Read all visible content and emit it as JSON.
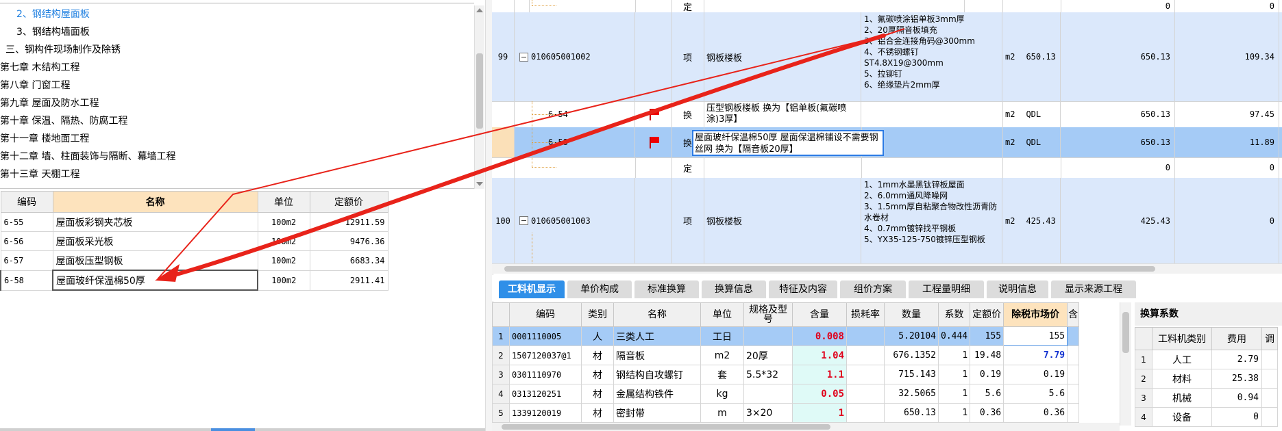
{
  "tree": {
    "items": [
      {
        "label": "2、钢结构屋面板",
        "selected": true
      },
      {
        "label": "3、钢结构墙面板",
        "selected": false
      },
      {
        "label": "三、钢构件现场制作及除锈",
        "selected": false
      },
      {
        "label": "第七章  木结构工程",
        "selected": false
      },
      {
        "label": "第八章  门窗工程",
        "selected": false
      },
      {
        "label": "第九章  屋面及防水工程",
        "selected": false
      },
      {
        "label": "第十章  保温、隔热、防腐工程",
        "selected": false
      },
      {
        "label": "第十一章  楼地面工程",
        "selected": false
      },
      {
        "label": "第十二章  墙、柱面装饰与隔断、幕墙工程",
        "selected": false
      },
      {
        "label": "第十三章  天棚工程",
        "selected": false
      }
    ]
  },
  "quota_table": {
    "headers": [
      "编码",
      "名称",
      "单位",
      "定额价"
    ],
    "rows": [
      {
        "code": "6-55",
        "name": "屋面板彩钢夹芯板",
        "unit": "100m2",
        "price": "12911.59"
      },
      {
        "code": "6-56",
        "name": "屋面板采光板",
        "unit": "100m2",
        "price": "9476.36"
      },
      {
        "code": "6-57",
        "name": "屋面板压型钢板",
        "unit": "100m2",
        "price": "6683.34"
      },
      {
        "code": "6-58",
        "name": "屋面玻纤保温棉50厚",
        "unit": "100m2",
        "price": "2911.41"
      }
    ]
  },
  "grid": {
    "row0": {
      "type": "定",
      "total": "0",
      "amount": "0"
    },
    "row99": {
      "seq": "99",
      "code": "010605001002",
      "type": "项",
      "name": "钢板楼板",
      "desc": "1、氟碳喷涂铝单板3mm厚\n2、20厚隔音板填充\n3、铝合金连接角码@300mm\n4、不锈钢螺钉\nST4.8X19@300mm\n5、拉铆钉\n6、绝缘垫片2mm厚",
      "unit": "m2",
      "qty_expr": "650.13",
      "qty": "650.13",
      "amount": "109.34"
    },
    "row654": {
      "code": "6-54",
      "type": "换",
      "name": "压型钢板楼板  换为【铝单板(氟碳喷涂)3厚】",
      "unit": "m2",
      "qty_expr": "QDL",
      "qty": "650.13",
      "amount": "97.45"
    },
    "row658": {
      "code": "6-58",
      "type": "换",
      "name": "屋面玻纤保温棉50厚  屋面保温棉铺设不需要钢丝网  换为【隔音板20厚】",
      "unit": "m2",
      "qty_expr": "QDL",
      "qty": "650.13",
      "amount": "11.89"
    },
    "rowding": {
      "type": "定",
      "qty": "0",
      "amount": "0"
    },
    "row100": {
      "seq": "100",
      "code": "010605001003",
      "type": "项",
      "name": "钢板楼板",
      "desc": "1、1mm水墨黑钛锌板屋面\n2、6.0mm通风降噪网\n3、1.5mm厚自粘聚合物改性沥青防水卷材\n4、0.7mm镀锌找平钢板\n5、YX35-125-750镀锌压型钢板",
      "unit": "m2",
      "qty_expr": "425.43",
      "qty": "425.43",
      "amount": "0"
    }
  },
  "tabs": [
    "工料机显示",
    "单价构成",
    "标准换算",
    "换算信息",
    "特征及内容",
    "组价方案",
    "工程量明细",
    "说明信息",
    "显示来源工程"
  ],
  "materials": {
    "headers": [
      "编码",
      "类别",
      "名称",
      "单位",
      "规格及型号",
      "含量",
      "损耗率",
      "数量",
      "系数",
      "定额价",
      "除税市场价",
      "含"
    ],
    "rows": [
      {
        "n": "1",
        "code": "0001110005",
        "cat": "人",
        "name": "三类人工",
        "unit": "工日",
        "spec": "",
        "content": "0.008",
        "loss": "",
        "qty": "5.20104",
        "coef": "0.444",
        "price": "155",
        "market": "155"
      },
      {
        "n": "2",
        "code": "1507120037@1",
        "cat": "材",
        "name": "隔音板",
        "unit": "m2",
        "spec": "20厚",
        "content": "1.04",
        "loss": "",
        "qty": "676.1352",
        "coef": "1",
        "price": "19.48",
        "market": "7.79"
      },
      {
        "n": "3",
        "code": "0301110970",
        "cat": "材",
        "name": "钢结构自攻螺钉",
        "unit": "套",
        "spec": "5.5*32",
        "content": "1.1",
        "loss": "",
        "qty": "715.143",
        "coef": "1",
        "price": "0.19",
        "market": "0.19"
      },
      {
        "n": "4",
        "code": "0313120251",
        "cat": "材",
        "name": "金属结构铁件",
        "unit": "kg",
        "spec": "",
        "content": "0.05",
        "loss": "",
        "qty": "32.5065",
        "coef": "1",
        "price": "5.6",
        "market": "5.6"
      },
      {
        "n": "5",
        "code": "1339120019",
        "cat": "材",
        "name": "密封带",
        "unit": "m",
        "spec": "3×20",
        "content": "1",
        "loss": "",
        "qty": "650.13",
        "coef": "1",
        "price": "0.36",
        "market": "0.36"
      }
    ]
  },
  "coef_panel": {
    "title": "换算系数",
    "headers": [
      "工料机类别",
      "费用",
      "调"
    ],
    "rows": [
      {
        "n": "1",
        "cat": "人工",
        "fee": "2.79"
      },
      {
        "n": "2",
        "cat": "材料",
        "fee": "25.38"
      },
      {
        "n": "3",
        "cat": "机械",
        "fee": "0.94"
      },
      {
        "n": "4",
        "cat": "设备",
        "fee": "0"
      }
    ]
  },
  "colors": {
    "accent": "#2f8fe8",
    "annotation_arrow": "#e8231a",
    "header_highlight": "#fde3bd",
    "selected_row": "#a5cbf6"
  }
}
